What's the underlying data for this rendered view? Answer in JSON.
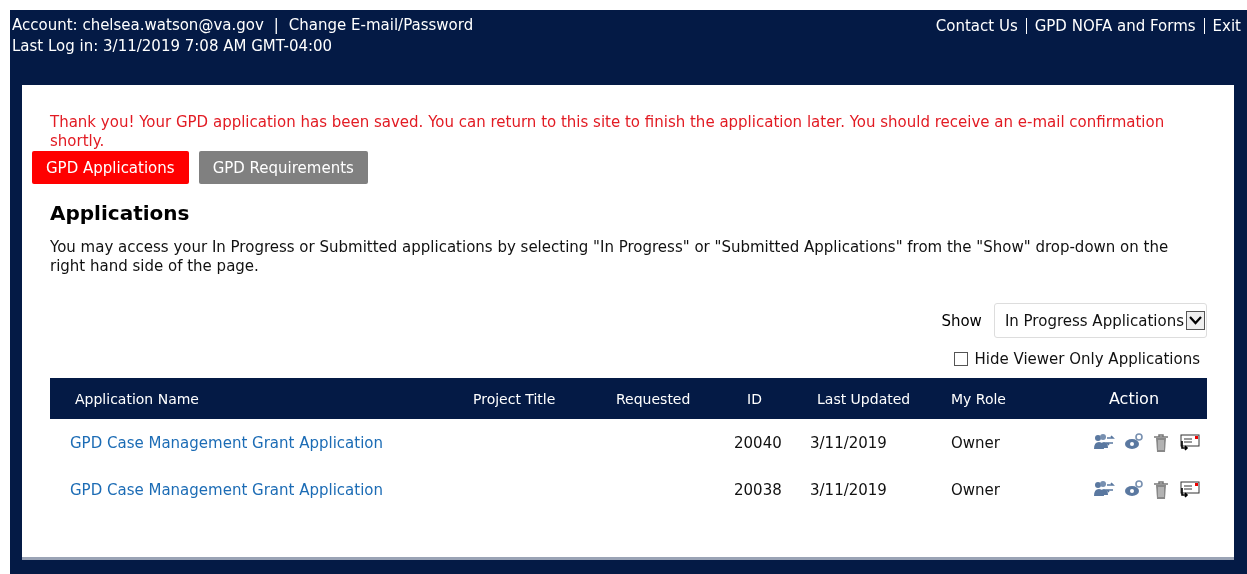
{
  "header": {
    "account": "Account: chelsea.watson@va.gov",
    "separator": "|",
    "change_link": "Change E-mail/Password",
    "last_login": "Last Log in: 3/11/2019 7:08 AM GMT-04:00",
    "links": [
      "Contact Us",
      "GPD NOFA and Forms",
      "Exit"
    ]
  },
  "message": "Thank you! Your GPD application has been saved. You can return to this site to finish the application later. You should receive an e-mail confirmation shortly.",
  "tabs": [
    {
      "label": "GPD Applications",
      "selected": true
    },
    {
      "label": "GPD Requirements",
      "selected": false
    }
  ],
  "heading": "Applications",
  "intro": "You may access your In Progress or Submitted applications by selecting \"In Progress\" or \"Submitted Applications\" from the \"Show\" drop-down on the right hand side of the page.",
  "show": {
    "label": "Show",
    "value": "In Progress Applications"
  },
  "hide_viewer_only": {
    "label": "Hide Viewer Only Applications",
    "checked": false
  },
  "table": {
    "columns": [
      "Application Name",
      "Project Title",
      "Requested",
      "ID",
      "Last Updated",
      "My Role",
      "Action"
    ],
    "rows": [
      {
        "name": "GPD Case Management Grant Application",
        "id": "20040",
        "last_updated": "3/11/2019",
        "role": "Owner"
      },
      {
        "name": "GPD Case Management Grant Application",
        "id": "20038",
        "last_updated": "3/11/2019",
        "role": "Owner"
      }
    ]
  }
}
